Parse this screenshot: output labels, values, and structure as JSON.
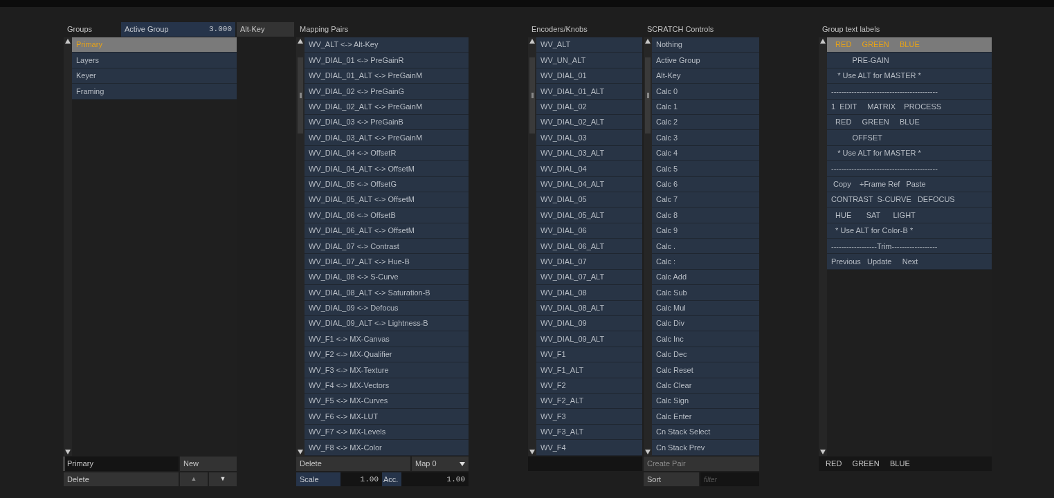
{
  "groups": {
    "title": "Groups",
    "active_group": {
      "label": "Active Group",
      "value": "3.000"
    },
    "alt_key_button": "Alt-Key",
    "items": [
      {
        "label": "Primary",
        "selected": true
      },
      {
        "label": "Layers",
        "selected": false
      },
      {
        "label": "Keyer",
        "selected": false
      },
      {
        "label": "Framing",
        "selected": false
      }
    ],
    "name_field": {
      "value": "Primary"
    },
    "new_button": "New",
    "delete_button": "Delete",
    "move_up": {
      "label": "▲",
      "disabled": true
    },
    "move_down": {
      "label": "▼",
      "disabled": false
    }
  },
  "mapping_pairs": {
    "title": "Mapping Pairs",
    "items": [
      "WV_ALT <-> Alt-Key",
      "WV_DIAL_01 <-> PreGainR",
      "WV_DIAL_01_ALT <-> PreGainM",
      "WV_DIAL_02 <-> PreGainG",
      "WV_DIAL_02_ALT <-> PreGainM",
      "WV_DIAL_03 <-> PreGainB",
      "WV_DIAL_03_ALT <-> PreGainM",
      "WV_DIAL_04 <-> OffsetR",
      "WV_DIAL_04_ALT <-> OffsetM",
      "WV_DIAL_05 <-> OffsetG",
      "WV_DIAL_05_ALT <-> OffsetM",
      "WV_DIAL_06 <-> OffsetB",
      "WV_DIAL_06_ALT <-> OffsetM",
      "WV_DIAL_07 <-> Contrast",
      "WV_DIAL_07_ALT <-> Hue-B",
      "WV_DIAL_08 <-> S-Curve",
      "WV_DIAL_08_ALT <-> Saturation-B",
      "WV_DIAL_09 <-> Defocus",
      "WV_DIAL_09_ALT <-> Lightness-B",
      "WV_F1 <-> MX-Canvas",
      "WV_F2 <-> MX-Qualifier",
      "WV_F3 <-> MX-Texture",
      "WV_F4 <-> MX-Vectors",
      "WV_F5 <-> MX-Curves",
      "WV_F6 <-> MX-LUT",
      "WV_F7 <-> MX-Levels",
      "WV_F8 <-> MX-Color"
    ],
    "delete_button": "Delete",
    "map_dropdown": "Map 0",
    "scale": {
      "label": "Scale",
      "value": "1.00"
    },
    "acc": {
      "label": "Acc.",
      "value": "1.00"
    }
  },
  "encoders": {
    "title": "Encoders/Knobs",
    "items": [
      "WV_ALT",
      "WV_UN_ALT",
      "WV_DIAL_01",
      "WV_DIAL_01_ALT",
      "WV_DIAL_02",
      "WV_DIAL_02_ALT",
      "WV_DIAL_03",
      "WV_DIAL_03_ALT",
      "WV_DIAL_04",
      "WV_DIAL_04_ALT",
      "WV_DIAL_05",
      "WV_DIAL_05_ALT",
      "WV_DIAL_06",
      "WV_DIAL_06_ALT",
      "WV_DIAL_07",
      "WV_DIAL_07_ALT",
      "WV_DIAL_08",
      "WV_DIAL_08_ALT",
      "WV_DIAL_09",
      "WV_DIAL_09_ALT",
      "WV_F1",
      "WV_F1_ALT",
      "WV_F2",
      "WV_F2_ALT",
      "WV_F3",
      "WV_F3_ALT",
      "WV_F4"
    ]
  },
  "scratch_controls": {
    "title": "SCRATCH Controls",
    "items": [
      "Nothing",
      "Active Group",
      "Alt-Key",
      "Calc 0",
      "Calc 1",
      "Calc 2",
      "Calc 3",
      "Calc 4",
      "Calc 5",
      "Calc 6",
      "Calc 7",
      "Calc 8",
      "Calc 9",
      "Calc .",
      "Calc :",
      "Calc Add",
      "Calc Sub",
      "Calc Mul",
      "Calc Div",
      "Calc Inc",
      "Calc Dec",
      "Calc Reset",
      "Calc Clear",
      "Calc Sign",
      "Calc Enter",
      "Cn Stack Select",
      "Cn Stack Prev"
    ],
    "create_pair": {
      "label": "Create Pair",
      "disabled": true
    },
    "sort_button": "Sort",
    "filter_field": {
      "placeholder": "filter"
    }
  },
  "group_text_labels": {
    "title": "Group text labels",
    "items": [
      {
        "label": "  RED     GREEN     BLUE",
        "selected": true
      },
      {
        "label": "          PRE-GAIN",
        "selected": false
      },
      {
        "label": "   * Use ALT for MASTER *",
        "selected": false
      },
      {
        "label": "------------------------------------------",
        "selected": false
      },
      {
        "label": "1  EDIT     MATRIX    PROCESS",
        "selected": false
      },
      {
        "label": "  RED     GREEN     BLUE",
        "selected": false
      },
      {
        "label": "          OFFSET",
        "selected": false
      },
      {
        "label": "   * Use ALT for MASTER *",
        "selected": false
      },
      {
        "label": "------------------------------------------",
        "selected": false
      },
      {
        "label": " Copy    +Frame Ref   Paste",
        "selected": false
      },
      {
        "label": "CONTRAST  S-CURVE   DEFOCUS",
        "selected": false
      },
      {
        "label": "  HUE       SAT      LIGHT",
        "selected": false
      },
      {
        "label": "  * Use ALT for Color-B *",
        "selected": false
      },
      {
        "label": "------------------Trim------------------",
        "selected": false
      },
      {
        "label": "Previous   Update     Next",
        "selected": false
      }
    ],
    "preview": "  RED     GREEN     BLUE"
  }
}
